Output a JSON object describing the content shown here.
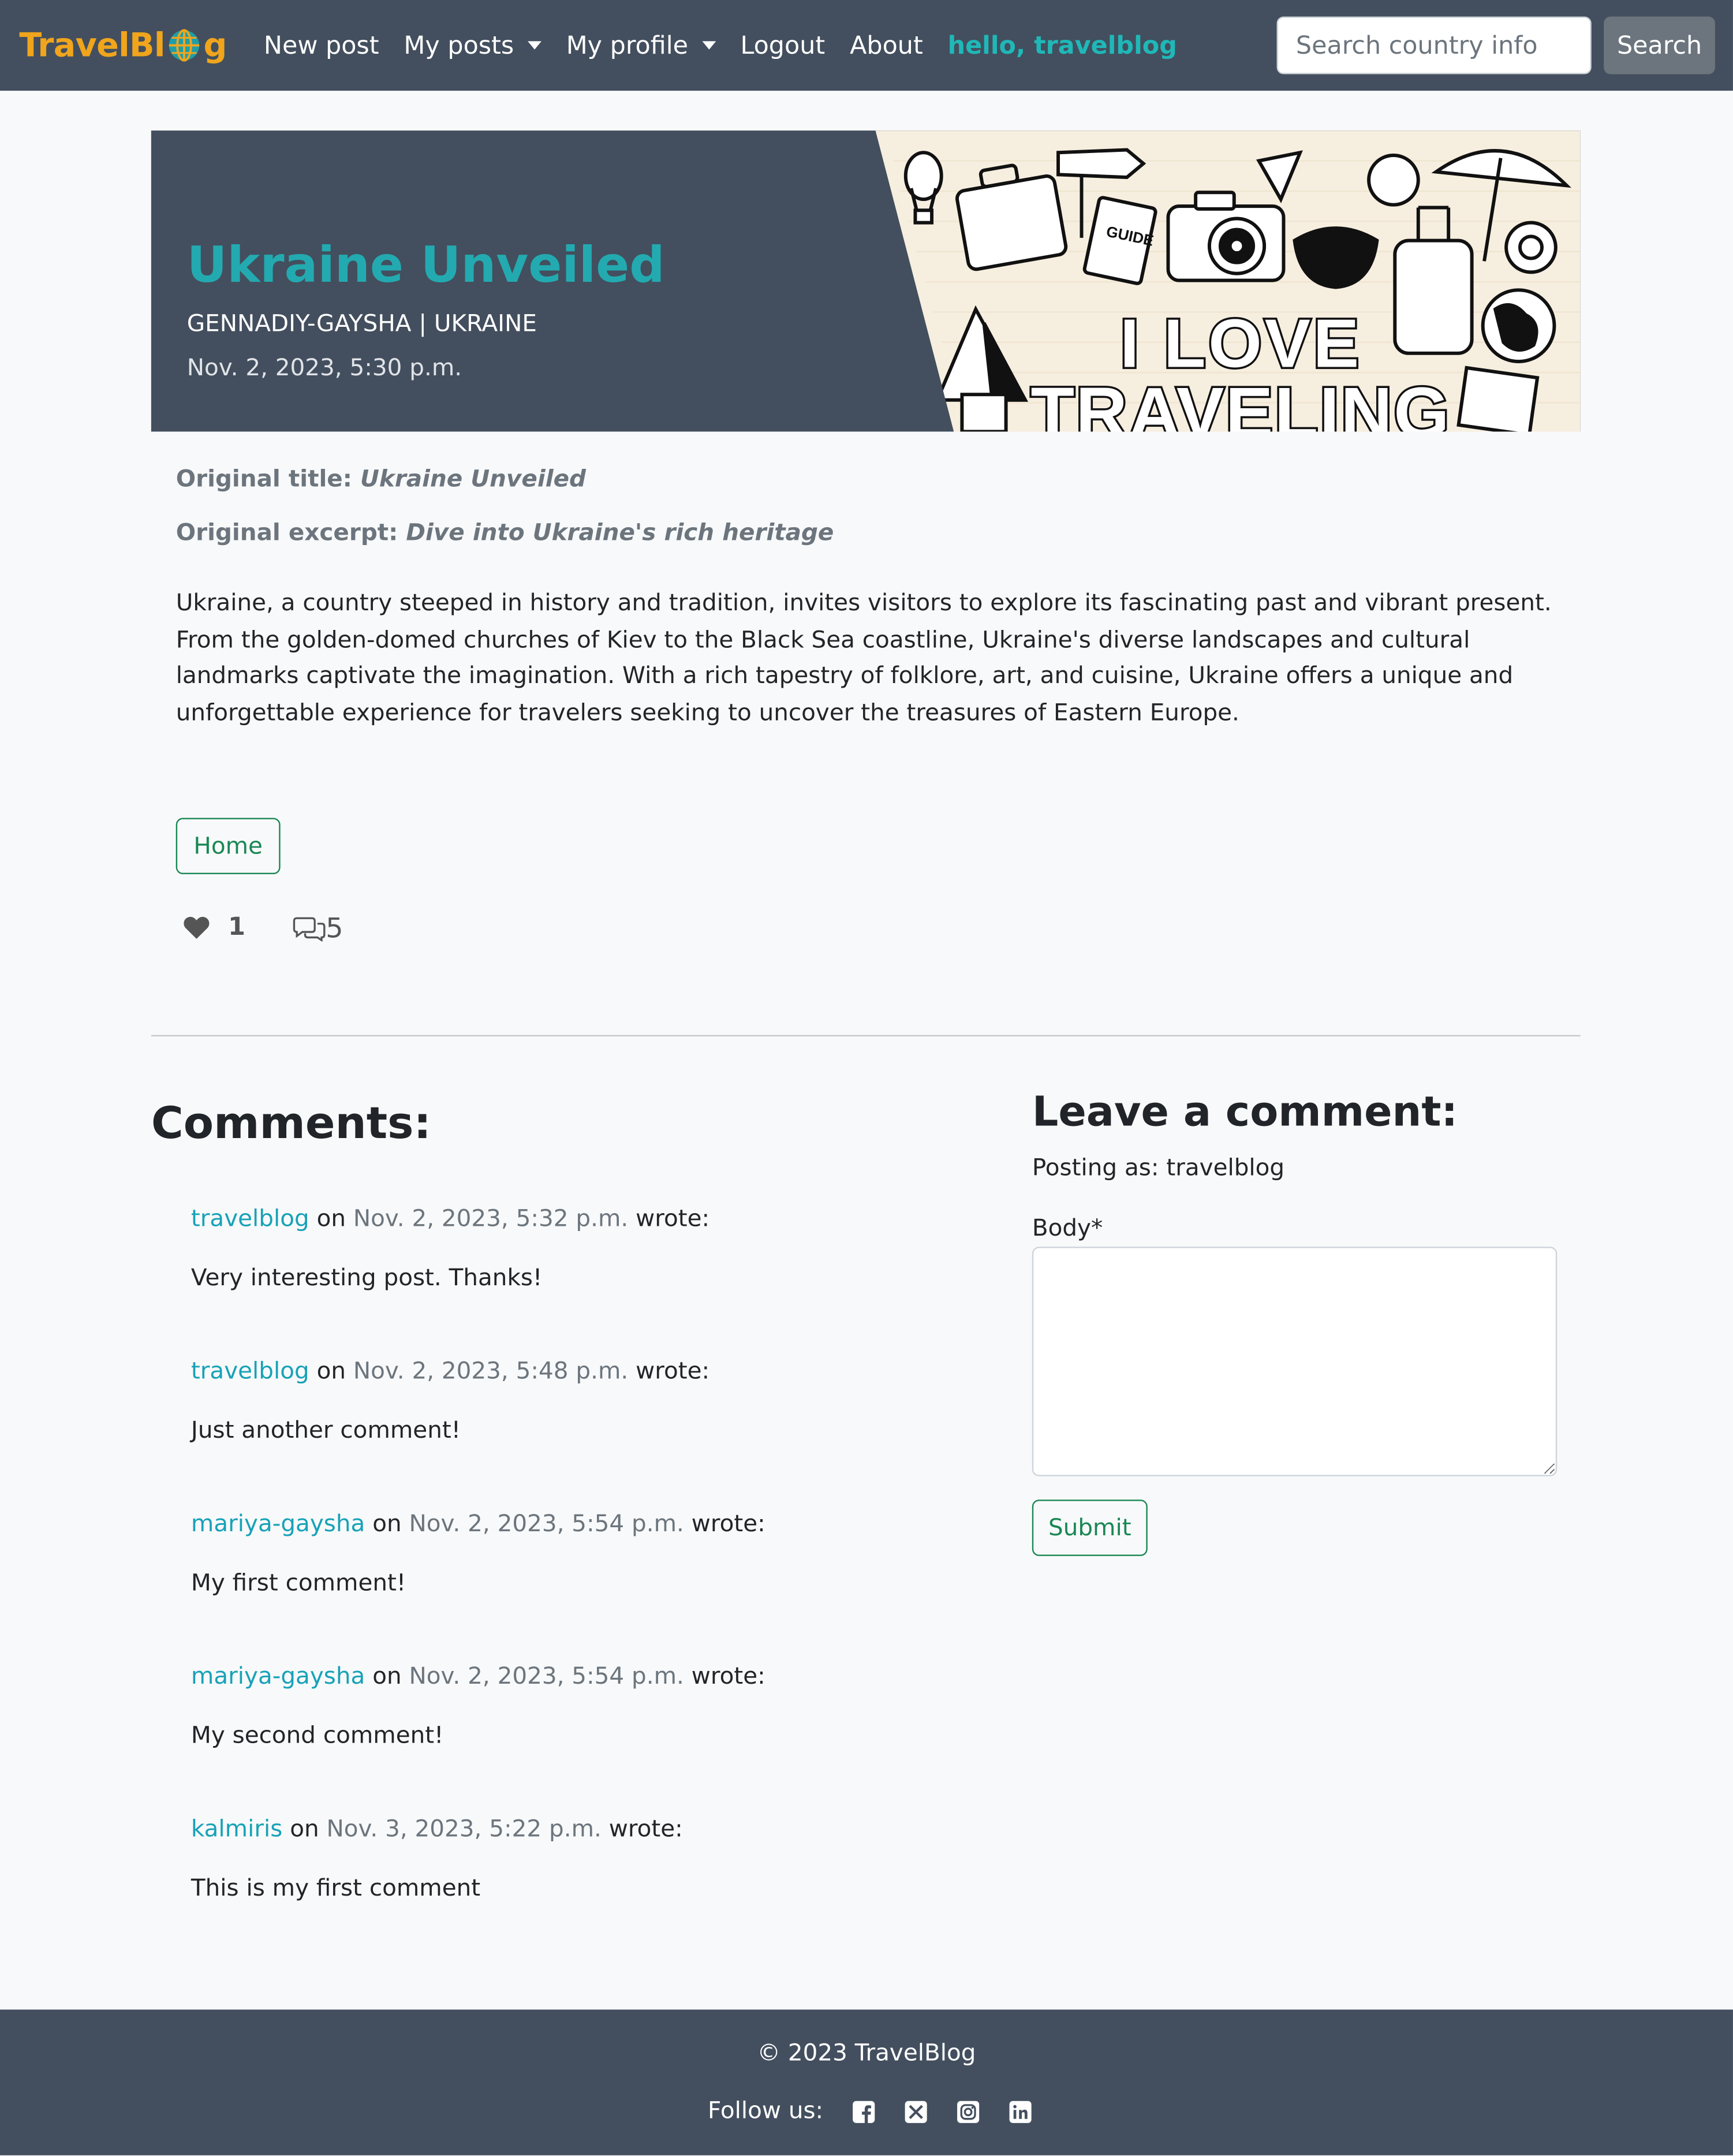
{
  "navbar": {
    "brand_prefix": "TravelBl",
    "brand_suffix": "g",
    "links": {
      "new_post": "New post",
      "my_posts": "My posts",
      "my_profile": "My profile",
      "logout": "Logout",
      "about": "About"
    },
    "greeting": "hello, travelblog",
    "search_placeholder": "Search country info",
    "search_button": "Search"
  },
  "post": {
    "title": "Ukraine Unveiled",
    "author_country": "GENNADIY-GAYSHA | UKRAINE",
    "date": "Nov. 2, 2023, 5:30 p.m.",
    "banner_text_1": "I LOVE",
    "banner_text_2": "TRAVELING",
    "banner_guide": "GUIDE",
    "original_title_label": "Original title:",
    "original_title": "Ukraine Unveiled",
    "original_excerpt_label": "Original excerpt:",
    "original_excerpt": "Dive into Ukraine's rich heritage",
    "body": "Ukraine, a country steeped in history and tradition, invites visitors to explore its fascinating past and vibrant present. From the golden-domed churches of Kiev to the Black Sea coastline, Ukraine's diverse landscapes and cultural landmarks captivate the imagination. With a rich tapestry of folklore, art, and cuisine, Ukraine offers a unique and unforgettable experience for travelers seeking to uncover the treasures of Eastern Europe.",
    "home_button": "Home",
    "likes": "1",
    "comment_count": "5"
  },
  "comments": {
    "heading": "Comments:",
    "on_word": "on",
    "wrote_word": "wrote:",
    "items": [
      {
        "author": "travelblog",
        "date": "Nov. 2, 2023, 5:32 p.m.",
        "body": "Very interesting post. Thanks!"
      },
      {
        "author": "travelblog",
        "date": "Nov. 2, 2023, 5:48 p.m.",
        "body": "Just another comment!"
      },
      {
        "author": "mariya-gaysha",
        "date": "Nov. 2, 2023, 5:54 p.m.",
        "body": "My first comment!"
      },
      {
        "author": "mariya-gaysha",
        "date": "Nov. 2, 2023, 5:54 p.m.",
        "body": "My second comment!"
      },
      {
        "author": "kalmiris",
        "date": "Nov. 3, 2023, 5:22 p.m.",
        "body": "This is my first comment"
      }
    ]
  },
  "comment_form": {
    "heading": "Leave a comment:",
    "posting_as": "Posting as: travelblog",
    "body_label": "Body*",
    "body_value": "",
    "submit_button": "Submit"
  },
  "footer": {
    "copyright": "© 2023 TravelBlog",
    "follow_label": "Follow us:",
    "social_icons": [
      "facebook-icon",
      "x-icon",
      "instagram-icon",
      "linkedin-icon"
    ]
  },
  "colors": {
    "navbar_bg": "#434f5e",
    "brand": "#f0a51c",
    "accent_teal": "#23aab0",
    "link": "#17a2b8",
    "success": "#198754",
    "page_bg": "#f8f9fa"
  }
}
